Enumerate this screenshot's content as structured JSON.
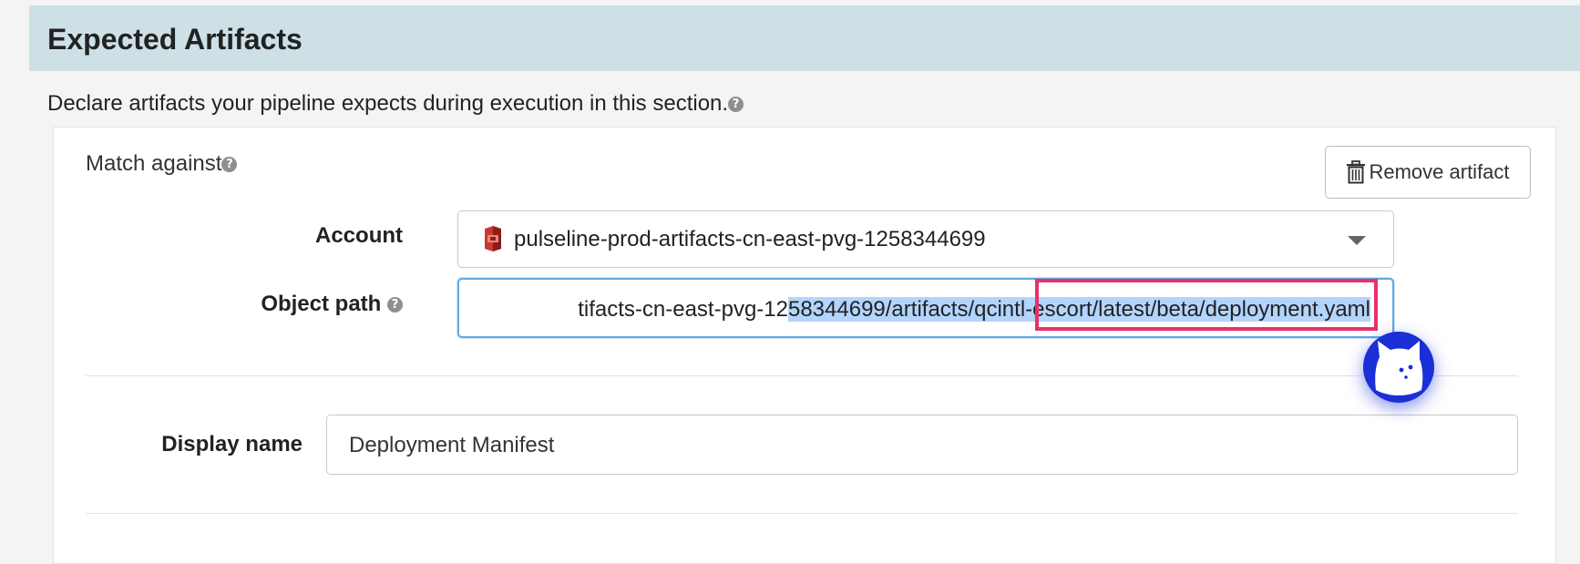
{
  "section": {
    "title": "Expected Artifacts",
    "intro": "Declare artifacts your pipeline expects during execution in this section."
  },
  "artifact": {
    "match_label": "Match against",
    "remove_label": "Remove artifact",
    "account": {
      "label": "Account",
      "value": "pulseline-prod-artifacts-cn-east-pvg-1258344699",
      "icon": "s3-bucket-icon"
    },
    "object_path": {
      "label": "Object path",
      "value_unselected": "tifacts-cn-east-pvg-12",
      "value_selected": "58344699/artifacts/qcintl-escort/latest/beta/deployment.yaml"
    },
    "display_name": {
      "label": "Display name",
      "value": "Deployment Manifest"
    }
  },
  "colors": {
    "header_bg": "#cde0e6",
    "selection": "#b3d4fc",
    "focus_border": "#66a8dd",
    "annotation": "#e8316b",
    "assistant_bubble": "#1a2fd6"
  }
}
